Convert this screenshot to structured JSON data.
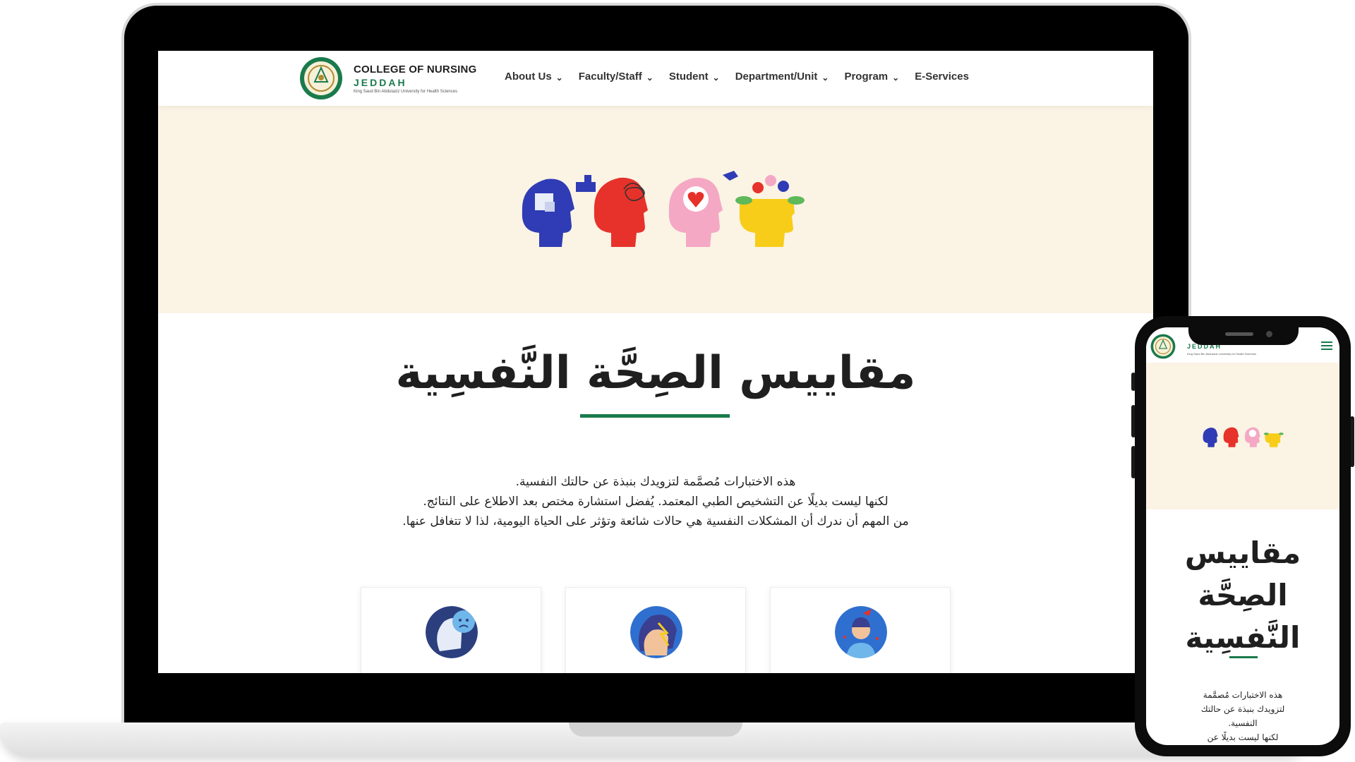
{
  "site": {
    "logo_title": "COLLEGE OF NURSING",
    "logo_city": "JEDDAH",
    "logo_university": "King Saud Bin Abdulaziz University for Health Sciences"
  },
  "nav": {
    "items": [
      {
        "label": "About Us",
        "has_dropdown": true
      },
      {
        "label": "Faculty/Staff",
        "has_dropdown": true
      },
      {
        "label": "Student",
        "has_dropdown": true
      },
      {
        "label": "Department/Unit",
        "has_dropdown": true
      },
      {
        "label": "Program",
        "has_dropdown": true
      },
      {
        "label": "E-Services",
        "has_dropdown": false
      }
    ]
  },
  "hero": {
    "illustration": "four-heads-mental-health-icons"
  },
  "page": {
    "title": "مقاييس الصِحَّة النَّفسِية",
    "intro_lines": [
      "هذه الاختبارات مُصمَّمة لتزويدك بنبذة عن حالتك النفسية.",
      "لكنها ليست بديلًا عن التشخيص الطبي المعتمد. يُفضل استشارة مختص بعد الاطلاع على النتائج.",
      "من المهم أن ندرك أن المشكلات النفسية هي حالات شائعة وتؤثر على الحياة اليومية، لذا لا تتغافل عنها."
    ]
  },
  "cards": [
    {
      "icon": "sad-face-head-icon"
    },
    {
      "icon": "anxiety-head-icon"
    },
    {
      "icon": "stress-person-icon"
    }
  ],
  "mobile": {
    "logo_city": "JEDDAH",
    "logo_university": "King Saud Bin Abdulaziz University for Health Sciences",
    "title_lines": [
      "مقاييس",
      "الصِحَّة",
      "النَّفسِية"
    ],
    "intro_lines": [
      "هذه الاختبارات مُصمَّمة",
      "لتزويدك بنبذة عن حالتك",
      "النفسية.",
      "لكنها ليست بديلًا عن"
    ]
  },
  "colors": {
    "brand_green": "#1a7a4c",
    "hero_bg": "#fbf3e4",
    "device_frame": "#000000"
  }
}
